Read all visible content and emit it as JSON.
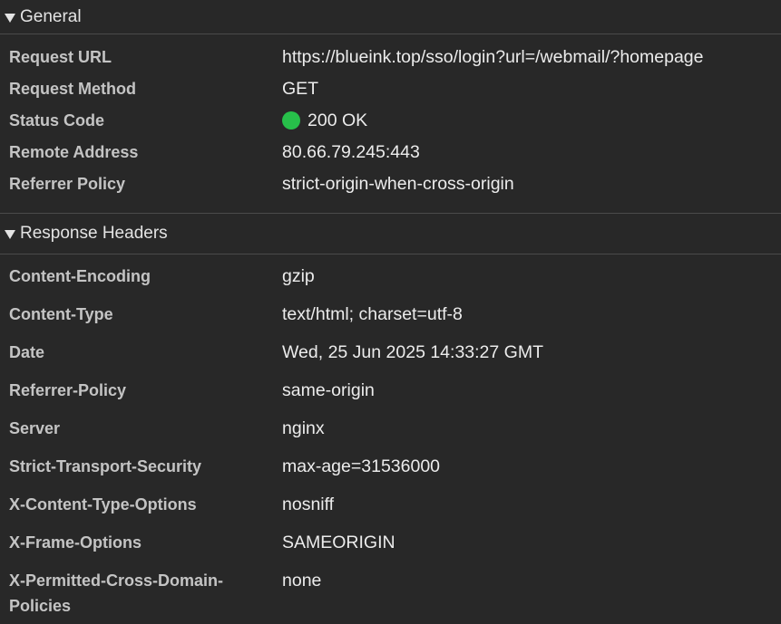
{
  "general": {
    "title": "General",
    "rows": [
      {
        "key": "Request URL",
        "value": "https://blueink.top/sso/login?url=/webmail/?homepage"
      },
      {
        "key": "Request Method",
        "value": "GET"
      },
      {
        "key": "Status Code",
        "value": "200 OK"
      },
      {
        "key": "Remote Address",
        "value": "80.66.79.245:443"
      },
      {
        "key": "Referrer Policy",
        "value": "strict-origin-when-cross-origin"
      }
    ],
    "status_color": "#27c04a"
  },
  "response_headers": {
    "title": "Response Headers",
    "rows": [
      {
        "key": "Content-Encoding",
        "value": "gzip"
      },
      {
        "key": "Content-Type",
        "value": "text/html; charset=utf-8"
      },
      {
        "key": "Date",
        "value": "Wed, 25 Jun 2025 14:33:27 GMT"
      },
      {
        "key": "Referrer-Policy",
        "value": "same-origin"
      },
      {
        "key": "Server",
        "value": "nginx"
      },
      {
        "key": "Strict-Transport-Security",
        "value": "max-age=31536000"
      },
      {
        "key": "X-Content-Type-Options",
        "value": "nosniff"
      },
      {
        "key": "X-Frame-Options",
        "value": "SAMEORIGIN"
      },
      {
        "key_line1": "X-Permitted-Cross-Domain-",
        "key_line2": "Policies",
        "value": "none"
      }
    ]
  }
}
